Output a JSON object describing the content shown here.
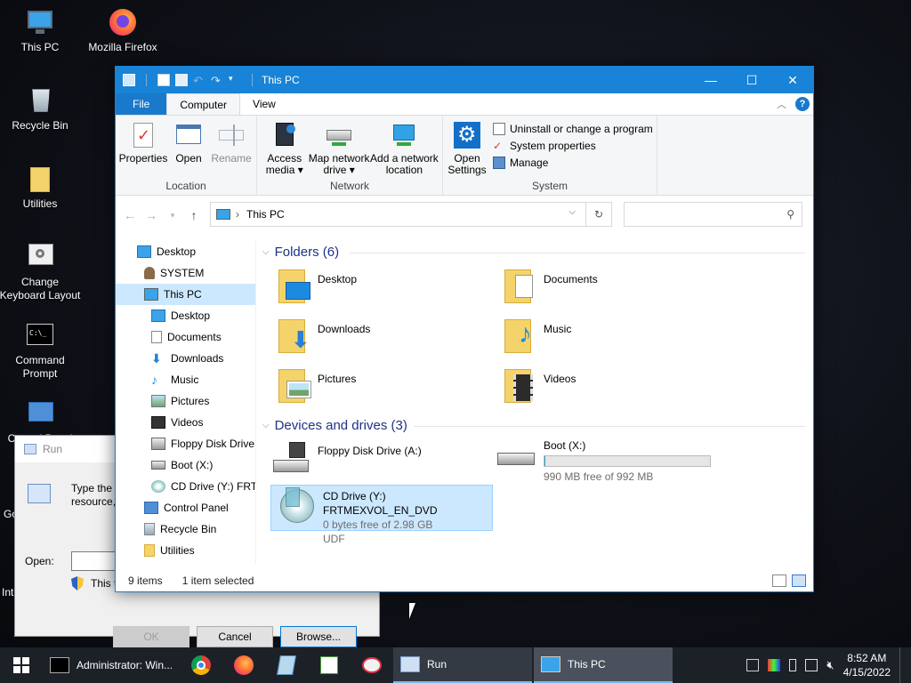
{
  "desktop": {
    "icons": [
      {
        "label": "This PC"
      },
      {
        "label": "Mozilla Firefox"
      },
      {
        "label": "Recycle Bin"
      },
      {
        "label": "Utilities"
      },
      {
        "label": "Change Keyboard Layout"
      },
      {
        "label": "Command Prompt"
      },
      {
        "label": "Control Panel"
      }
    ],
    "partial_labels": [
      "Go",
      "Int"
    ]
  },
  "run_dialog": {
    "title": "Run",
    "text_line1": "Type the n",
    "text_line2": "resource, ",
    "open_label": "Open:",
    "open_value": "",
    "admin_note": "This t",
    "ok": "OK",
    "cancel": "Cancel",
    "browse": "Browse..."
  },
  "explorer": {
    "title": "This PC",
    "tabs": {
      "file": "File",
      "computer": "Computer",
      "view": "View"
    },
    "ribbon": {
      "location": {
        "label": "Location",
        "properties": "Properties",
        "open": "Open",
        "rename": "Rename"
      },
      "network": {
        "label": "Network",
        "access_media_1": "Access",
        "access_media_2": "media",
        "map_drive_1": "Map network",
        "map_drive_2": "drive",
        "add_location_1": "Add a network",
        "add_location_2": "location"
      },
      "system": {
        "label": "System",
        "open_settings_1": "Open",
        "open_settings_2": "Settings",
        "uninstall": "Uninstall or change a program",
        "system_properties": "System properties",
        "manage": "Manage"
      }
    },
    "address": {
      "path": "This PC",
      "search_placeholder": ""
    },
    "nav": [
      {
        "label": "Desktop",
        "indent": 0
      },
      {
        "label": "SYSTEM",
        "indent": 1
      },
      {
        "label": "This PC",
        "indent": 1,
        "selected": true
      },
      {
        "label": "Desktop",
        "indent": 2
      },
      {
        "label": "Documents",
        "indent": 2
      },
      {
        "label": "Downloads",
        "indent": 2
      },
      {
        "label": "Music",
        "indent": 2
      },
      {
        "label": "Pictures",
        "indent": 2
      },
      {
        "label": "Videos",
        "indent": 2
      },
      {
        "label": "Floppy Disk Drive",
        "indent": 2
      },
      {
        "label": "Boot (X:)",
        "indent": 2
      },
      {
        "label": "CD Drive (Y:) FRTM",
        "indent": 2
      },
      {
        "label": "Control Panel",
        "indent": 1
      },
      {
        "label": "Recycle Bin",
        "indent": 1
      },
      {
        "label": "Utilities",
        "indent": 1
      }
    ],
    "folders_header": "Folders (6)",
    "folders": [
      "Desktop",
      "Documents",
      "Downloads",
      "Music",
      "Pictures",
      "Videos"
    ],
    "devices_header": "Devices and drives (3)",
    "drives": {
      "floppy": {
        "name": "Floppy Disk Drive (A:)"
      },
      "boot": {
        "name": "Boot (X:)",
        "free": "990 MB free of 992 MB",
        "used_fraction": 0.002
      },
      "cd": {
        "name": "CD Drive (Y:) FRTMEXVOL_EN_DVD",
        "free": "0 bytes free of 2.98 GB",
        "fs": "UDF"
      }
    },
    "status": {
      "items": "9 items",
      "selected": "1 item selected"
    }
  },
  "taskbar": {
    "apps": {
      "cmd": "Administrator: Win...",
      "run": "Run",
      "thispc": "This PC"
    },
    "time": "8:52 AM",
    "date": "4/15/2022"
  },
  "colors": {
    "accent": "#1883d7",
    "selection": "#cce8ff",
    "taskbar": "#1c2128"
  }
}
